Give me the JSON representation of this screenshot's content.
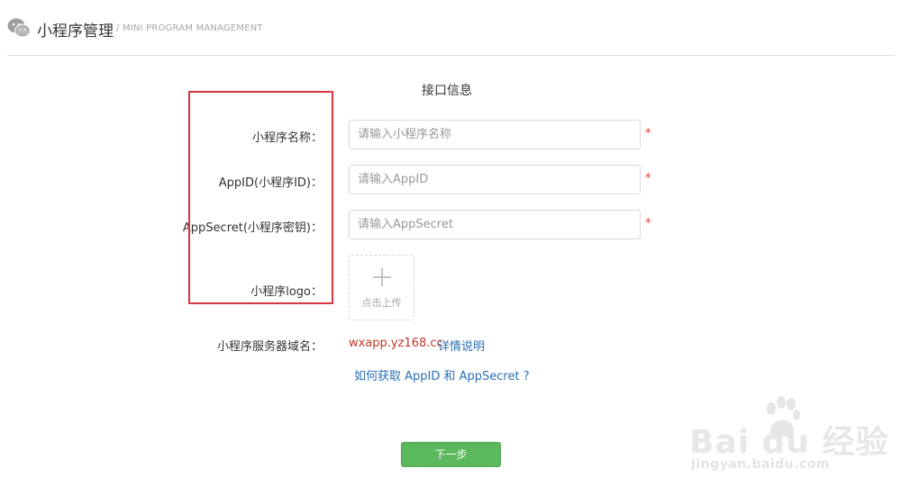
{
  "header": {
    "title": "小程序管理",
    "subtitle": "/ MINI PROGRAM MANAGEMENT"
  },
  "form": {
    "section_title": "接口信息",
    "fields": [
      {
        "label": "小程序名称：",
        "placeholder": "请输入小程序名称",
        "required": "*"
      },
      {
        "label": "AppID(小程序ID)：",
        "placeholder": "请输入AppID",
        "required": "*"
      },
      {
        "label": "AppSecret(小程序密钥)：",
        "placeholder": "请输入AppSecret",
        "required": "*"
      }
    ],
    "logo": {
      "label": "小程序logo：",
      "upload_text": "点击上传"
    },
    "domain": {
      "label": "小程序服务器域名：",
      "value": "wxapp.yz168.cc",
      "link": "详情说明"
    },
    "help_link": "如何获取 AppID 和 AppSecret ?",
    "next_button": "下一步"
  },
  "watermark": {
    "brand": "Bai du 经验",
    "url": "jingyan.baidu.com"
  },
  "colors": {
    "required": "#e23a3a",
    "link": "#2a6fb5",
    "domain": "#c0392b",
    "primary_button": "#5cb85c",
    "highlight": "#d9363e"
  },
  "icons": [
    "wechat-icon",
    "plus-icon",
    "baidu-paw-icon"
  ]
}
